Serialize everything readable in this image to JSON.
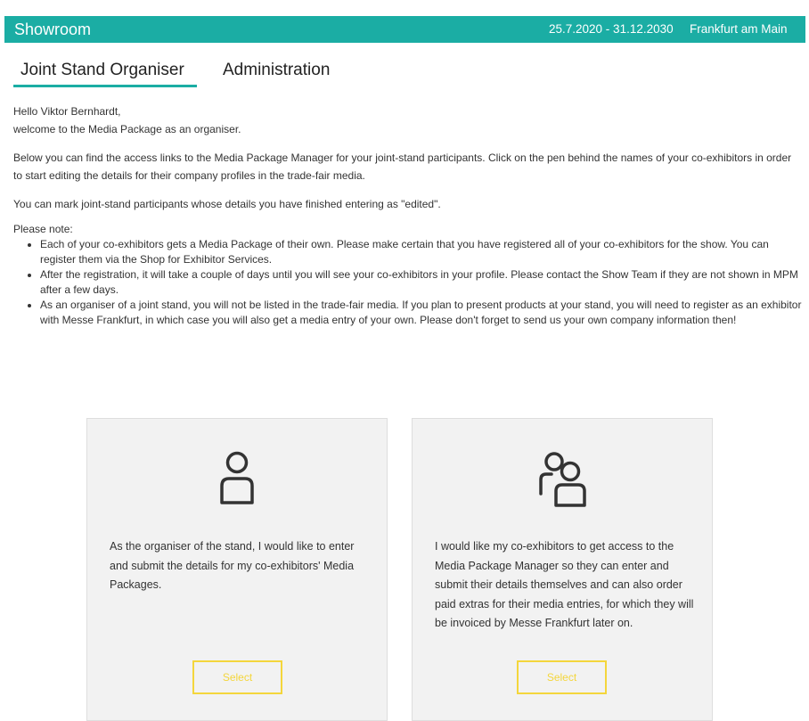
{
  "header": {
    "brand": "Showroom",
    "dates": "25.7.2020 - 31.12.2030",
    "city": "Frankfurt am Main",
    "background_color": "#1bada4"
  },
  "tabs": [
    {
      "label": "Joint Stand Organiser",
      "active": true
    },
    {
      "label": "Administration",
      "active": false
    }
  ],
  "intro": {
    "greeting": "Hello Viktor Bernhardt,",
    "welcome": "welcome to the Media Package as an organiser.",
    "para1": "Below you can find the access links to the Media Package Manager for your joint-stand participants. Click on the pen behind the names of your co-exhibitors in order to start editing the details for their company profiles in the trade-fair media.",
    "para2": "You can mark joint-stand participants whose details you have finished entering as \"edited\".",
    "note_heading": "Please note:",
    "notes": [
      "Each of your co-exhibitors gets a Media Package of their own. Please make certain that you have registered all of your co-exhibitors for the show. You can register them via the Shop for Exhibitor Services.",
      "After the registration, it will take a couple of days until you will see your co-exhibitors in your profile. Please contact the Show Team if they are not shown in MPM after a few days.",
      "As an organiser of a joint stand, you will not be listed in the trade-fair media. If you plan to present products at your stand, you will need to register as an exhibitor with Messe Frankfurt, in which case you will also get a media entry of your own. Please don't forget to send us your own company information then!"
    ]
  },
  "options": [
    {
      "icon": "single-user-icon",
      "description": "As the organiser of the stand, I would like to enter and submit the details for my co-exhibitors' Media Packages.",
      "button_label": "Select"
    },
    {
      "icon": "multiple-users-icon",
      "description": "I would like my co-exhibitors to get access to the Media Package Manager so they can enter and submit their details themselves and can also order paid extras for their media entries, for which they will be invoiced by Messe Frankfurt later on.",
      "button_label": "Select"
    }
  ],
  "colors": {
    "accent": "#1bada4",
    "button": "#f4d63c",
    "card_background": "#f2f2f2"
  }
}
